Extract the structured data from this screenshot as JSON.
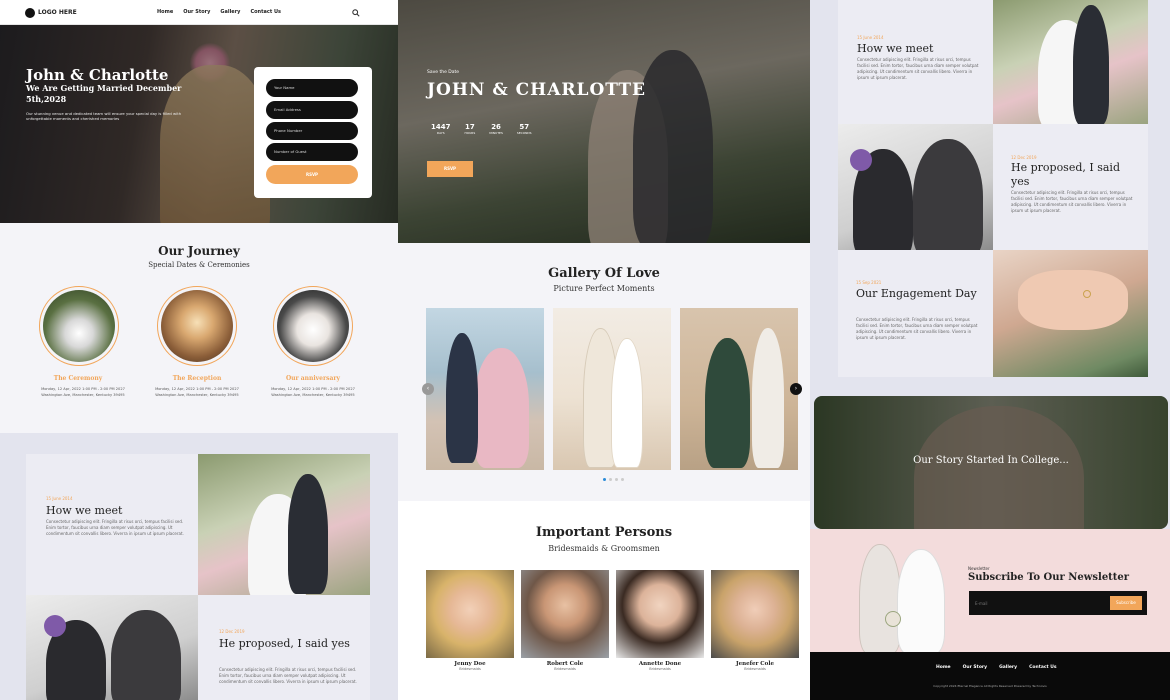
{
  "colors": {
    "accent": "#f2a65a",
    "dark": "#111111",
    "light_bg": "#f4f4f8"
  },
  "nav": {
    "logo": "LOGO HERE",
    "items": [
      "Home",
      "Our Story",
      "Gallery",
      "Contact Us"
    ],
    "search_icon": "search-icon"
  },
  "hero1": {
    "title": "John & Charlotte",
    "subtitle": "We Are Getting Married December 5th,2028",
    "text": "Our stunning venue and dedicated team will ensure your special day is filled with unforgettable moments and cherished memories",
    "form": {
      "fields": [
        "Your Name",
        "Email Address",
        "Phone Number",
        "Number of Guest"
      ],
      "button": "RSVP"
    }
  },
  "journey": {
    "title": "Our Journey",
    "subtitle": "Special Dates & Ceremonies",
    "events": [
      {
        "name": "The Ceremony",
        "date": "Monday, 12 Apr, 2022 1:00 PM - 2:00 PM 2027",
        "address": "Washington Ave, Manchester, Kentucky 39495"
      },
      {
        "name": "The Reception",
        "date": "Monday, 12 Apr, 2022 1:00 PM - 2:00 PM 2027",
        "address": "Washington Ave, Manchester, Kentucky 39495"
      },
      {
        "name": "Our anniversary",
        "date": "Monday, 12 Apr, 2022 1:00 PM - 2:00 PM 2027",
        "address": "Washington Ave, Manchester, Kentucky 39495"
      }
    ]
  },
  "story_left": {
    "how_date": "15 June 2014",
    "how_title": "How we meet",
    "how_text": "Consectetur adipiscing elit. Fringilla at risus orci, tempus facilisi sed. Enim tortor, faucibus urna diam semper volutpat adipiscing. Ut condimentum sit convallis libero. Viverra in ipsum ut ipsum placerat.",
    "proposed_date": "12 Dec 2019",
    "proposed_title": "He proposed, I said yes",
    "proposed_text": "Consectetur adipiscing elit. Fringilla at risus orci, tempus facilisi sed. Enim tortor, faucibus urna diam semper volutpat adipiscing. Ut condimentum sit convallis libero. Viverra in ipsum ut ipsum placerat."
  },
  "hero2": {
    "eyebrow": "Save the Date",
    "title": "JOHN & CHARLOTTE",
    "countdown": [
      {
        "value": "1447",
        "label": "DAYS"
      },
      {
        "value": "17",
        "label": "HOURS"
      },
      {
        "value": "26",
        "label": "MINUTES"
      },
      {
        "value": "57",
        "label": "SECONDS"
      }
    ],
    "button": "RSVP"
  },
  "gallery": {
    "title": "Gallery Of Love",
    "subtitle": "Picture Perfect Moments"
  },
  "persons": {
    "title": "Important Persons",
    "subtitle": "Bridesmaids & Groomsmen",
    "people": [
      {
        "name": "Jenny Doe",
        "role": "Bridesmaids"
      },
      {
        "name": "Robert Cole",
        "role": "Bridesmaids"
      },
      {
        "name": "Annette Done",
        "role": "Bridesmaids"
      },
      {
        "name": "Jenefer Cole",
        "role": "Bridesmaids"
      }
    ]
  },
  "story_right": {
    "how_date": "15 June 2014",
    "how_title": "How we meet",
    "how_text": "Consectetur adipiscing elit. Fringilla at risus orci, tempus facilisi sed. Enim tortor, faucibus urna diam semper volutpat adipiscing. Ut condimentum sit convallis libero. Viverra in ipsum ut ipsum placerat.",
    "proposed_date": "12 Dec 2019",
    "proposed_title": "He proposed, I said yes",
    "proposed_text": "Consectetur adipiscing elit. Fringilla at risus orci, tempus facilisi sed. Enim tortor, faucibus urna diam semper volutpat adipiscing. Ut condimentum sit convallis libero. Viverra in ipsum ut ipsum placerat.",
    "engage_date": "15 Sep 2021",
    "engage_title": "Our Engagement Day",
    "engage_text": "Consectetur adipiscing elit. Fringilla at risus orci, tempus facilisi sed. Enim tortor, faucibus urna diam semper volutpat adipiscing. Ut condimentum sit convallis libero. Viverra in ipsum ut ipsum placerat."
  },
  "college": {
    "text": "Our Story Started In College..."
  },
  "newsletter": {
    "eyebrow": "Newsletter",
    "title": "Subscribe To Our Newsletter",
    "placeholder": "E-mail",
    "button": "Subscribe"
  },
  "footer": {
    "items": [
      "Home",
      "Our Story",
      "Gallery",
      "Contact Us"
    ],
    "copyright": "Copyright 2024 Eternal Elegance All Rights Reserved Powered by Technovis"
  }
}
